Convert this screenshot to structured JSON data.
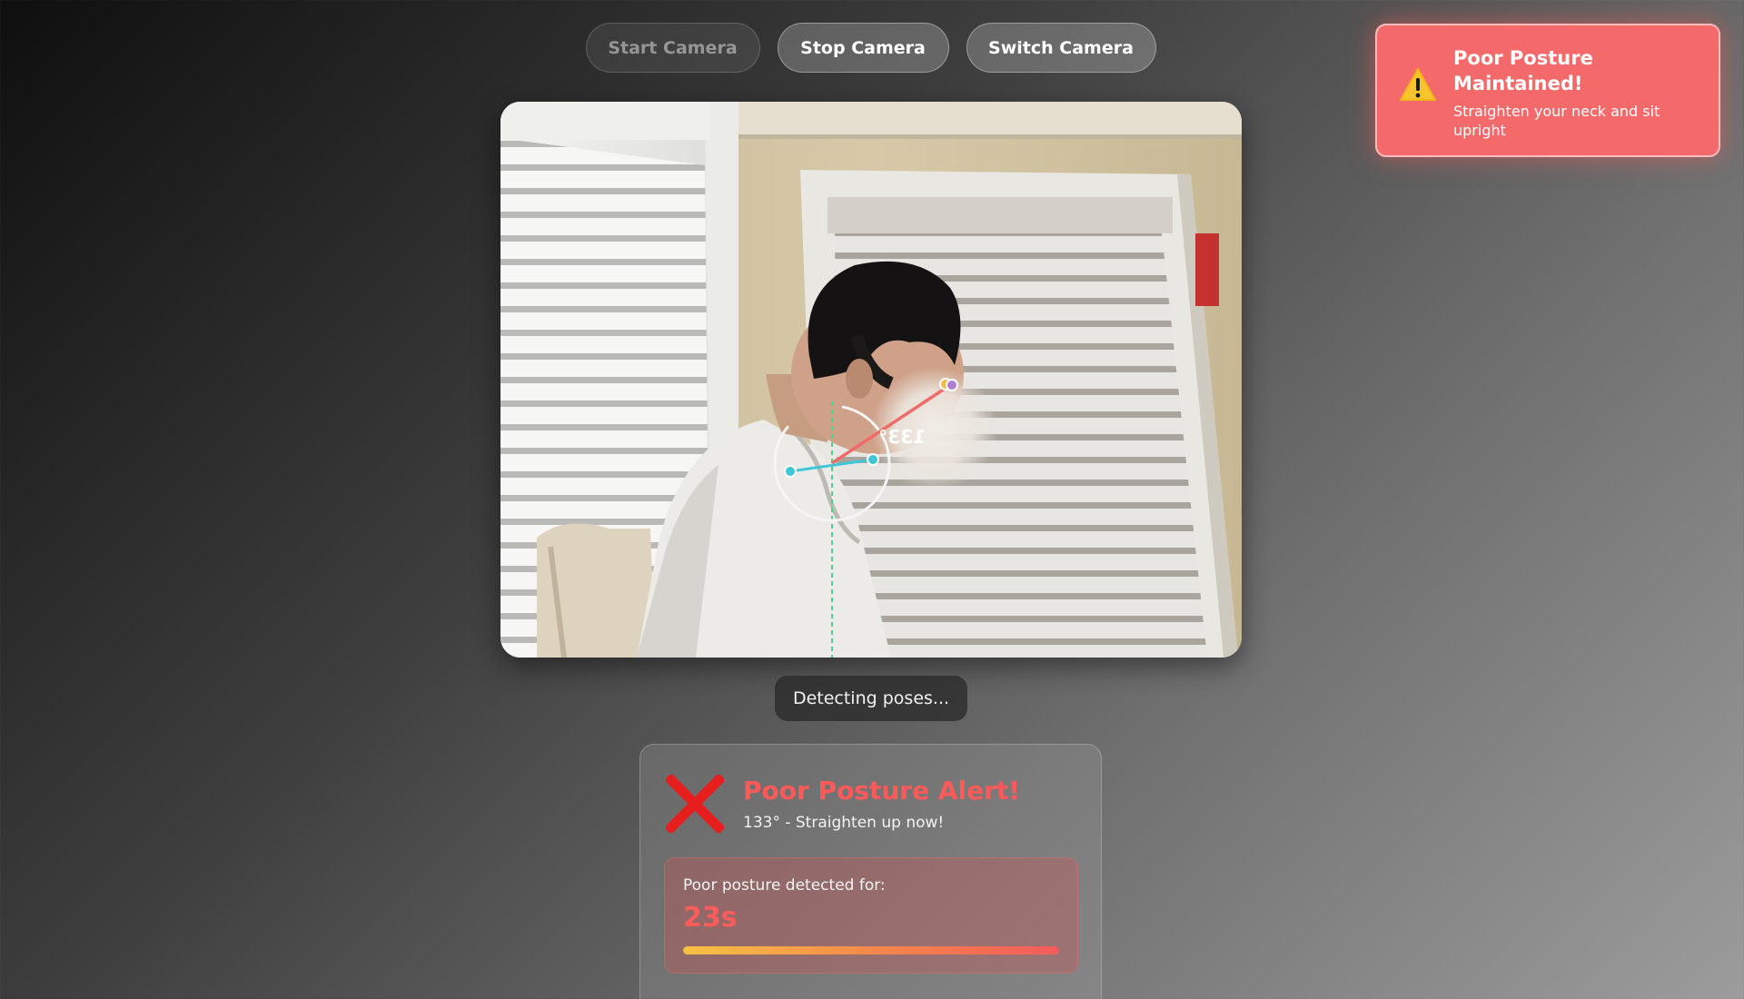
{
  "controls": {
    "start_label": "Start Camera",
    "stop_label": "Stop Camera",
    "switch_label": "Switch Camera"
  },
  "camera": {
    "angle_label": "133°"
  },
  "status": {
    "text": "Detecting poses..."
  },
  "alert": {
    "icon": "x-icon",
    "title": "Poor Posture Alert!",
    "subtitle": "133° - Straighten up now!",
    "timer_label": "Poor posture detected for:",
    "timer_value": "23s",
    "timer_progress": 1.0,
    "title_color": "#ff5a5a"
  },
  "toast": {
    "icon": "warning-icon",
    "title": "Poor Posture Maintained!",
    "message": "Straighten your neck and sit upright",
    "background": "#f46a6a"
  }
}
